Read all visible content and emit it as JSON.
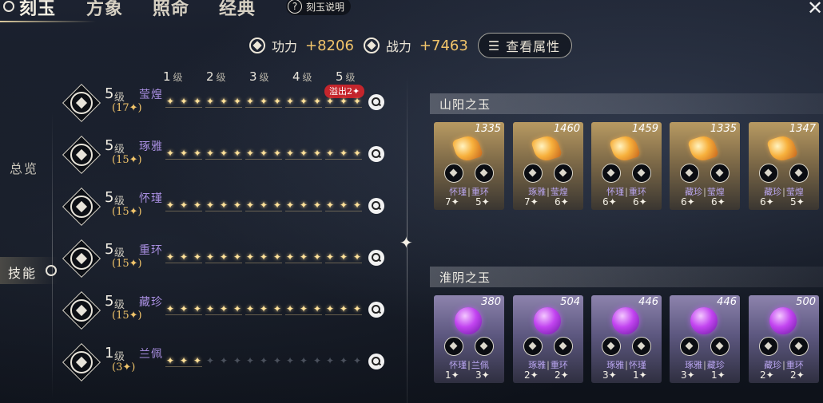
{
  "tabs": [
    {
      "label": "刻玉",
      "active": true
    },
    {
      "label": "方象",
      "active": false
    },
    {
      "label": "照命",
      "active": false
    },
    {
      "label": "经典",
      "active": false
    }
  ],
  "help": {
    "icon": "question-icon",
    "label": "刻玉说明"
  },
  "close_icon": "close-icon",
  "stats": {
    "gongli_label": "功力",
    "gongli_value": "+8206",
    "zhanli_label": "战力",
    "zhanli_value": "+7463",
    "attr_button": "查看属性"
  },
  "nav": {
    "overview": "总览",
    "skills": "技能"
  },
  "level_header": [
    {
      "num": "1",
      "unit": "级"
    },
    {
      "num": "2",
      "unit": "级"
    },
    {
      "num": "3",
      "unit": "级"
    },
    {
      "num": "4",
      "unit": "级"
    },
    {
      "num": "5",
      "unit": "级"
    }
  ],
  "overflow_badge": "溢出2✦",
  "skills": [
    {
      "level": "5",
      "unit": "级",
      "name": "莹煌",
      "points": "(17✦)",
      "filled_groups": 5
    },
    {
      "level": "5",
      "unit": "级",
      "name": "琢雅",
      "points": "(15✦)",
      "filled_groups": 5
    },
    {
      "level": "5",
      "unit": "级",
      "name": "怀瑾",
      "points": "(15✦)",
      "filled_groups": 5
    },
    {
      "level": "5",
      "unit": "级",
      "name": "重环",
      "points": "(15✦)",
      "filled_groups": 5
    },
    {
      "level": "5",
      "unit": "级",
      "name": "藏珍",
      "points": "(15✦)",
      "filled_groups": 5
    },
    {
      "level": "1",
      "unit": "级",
      "name": "兰佩",
      "points": "(3✦)",
      "filled_groups": 1
    }
  ],
  "sets": [
    {
      "title": "山阳之玉",
      "cards": [
        {
          "score": "1335",
          "name1": "怀瑾",
          "name2": "重环",
          "val1": "7✦",
          "val2": "5✦"
        },
        {
          "score": "1460",
          "name1": "琢雅",
          "name2": "莹煌",
          "val1": "7✦",
          "val2": "6✦"
        },
        {
          "score": "1459",
          "name1": "怀瑾",
          "name2": "重环",
          "val1": "6✦",
          "val2": "6✦"
        },
        {
          "score": "1335",
          "name1": "藏珍",
          "name2": "莹煌",
          "val1": "6✦",
          "val2": "6✦"
        },
        {
          "score": "1347",
          "name1": "藏珍",
          "name2": "莹煌",
          "val1": "6✦",
          "val2": "5✦"
        }
      ]
    },
    {
      "title": "淮阴之玉",
      "cards": [
        {
          "score": "380",
          "name1": "怀瑾",
          "name2": "兰佩",
          "val1": "1✦",
          "val2": "3✦"
        },
        {
          "score": "504",
          "name1": "琢雅",
          "name2": "重环",
          "val1": "2✦",
          "val2": "2✦"
        },
        {
          "score": "446",
          "name1": "琢雅",
          "name2": "怀瑾",
          "val1": "3✦",
          "val2": "1✦"
        },
        {
          "score": "446",
          "name1": "琢雅",
          "name2": "藏珍",
          "val1": "3✦",
          "val2": "1✦"
        },
        {
          "score": "500",
          "name1": "藏珍",
          "name2": "重环",
          "val1": "2✦",
          "val2": "2✦"
        }
      ]
    }
  ]
}
